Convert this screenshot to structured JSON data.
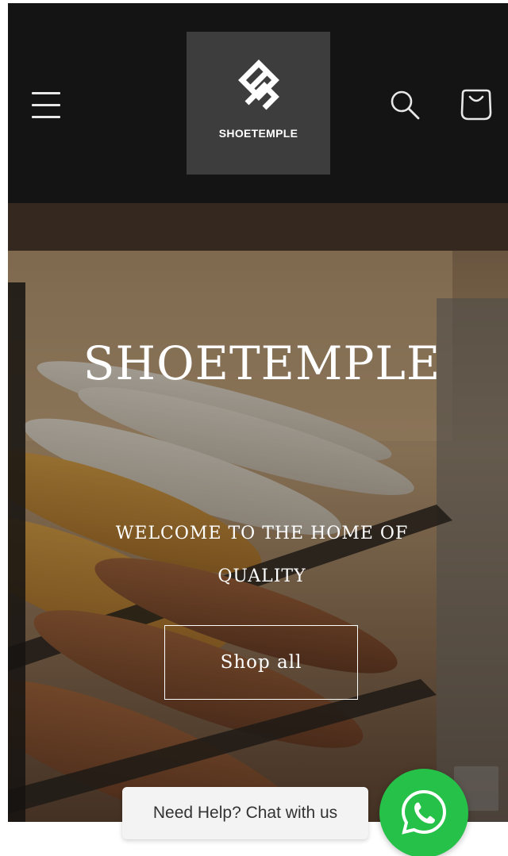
{
  "header": {
    "logo_text": "SHOETEMPLE",
    "background": "#141414",
    "icons": [
      "hamburger-menu-icon",
      "search-icon",
      "shopping-bag-icon"
    ]
  },
  "hero": {
    "title": "SHOETEMPLE",
    "subtitle": "WELCOME TO THE HOME OF QUALITY",
    "button_label": "Shop all"
  },
  "chat": {
    "bubble_text": "Need Help? Chat with us",
    "button_color": "#25c148",
    "icon": "whatsapp-icon"
  }
}
